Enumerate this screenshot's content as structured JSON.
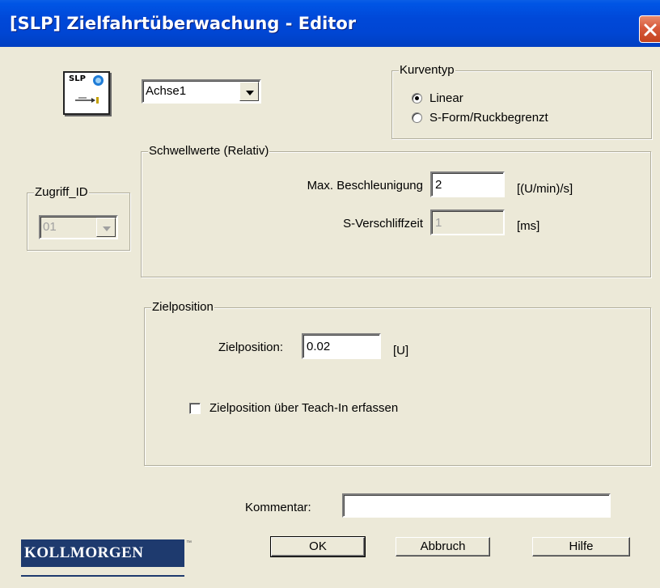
{
  "window": {
    "title": "[SLP] Zielfahrtüberwachung - Editor"
  },
  "icon": {
    "label": "SLP"
  },
  "axis": {
    "selected": "Achse1"
  },
  "kurventyp": {
    "legend": "Kurventyp",
    "options": [
      {
        "label": "Linear",
        "checked": true
      },
      {
        "label": "S-Form/Ruckbegrenzt",
        "checked": false
      }
    ]
  },
  "zugriff": {
    "legend": "Zugriff_ID",
    "selected": "01",
    "enabled": false
  },
  "schwellwerte": {
    "legend": "Schwellwerte (Relativ)",
    "max_accel_label": "Max. Beschleunigung",
    "max_accel_value": "2",
    "max_accel_unit": "[(U/min)/s]",
    "s_time_label": "S-Verschliffzeit",
    "s_time_value": "1",
    "s_time_unit": "[ms]"
  },
  "zielposition": {
    "legend": "Zielposition",
    "label": "Zielposition:",
    "value": "0.02",
    "unit": "[U]",
    "teach_in_label": "Zielposition über Teach-In erfassen",
    "teach_in_checked": false
  },
  "kommentar": {
    "label": "Kommentar:",
    "value": ""
  },
  "buttons": {
    "ok": "OK",
    "cancel": "Abbruch",
    "help": "Hilfe"
  },
  "brand": {
    "logo": "KOLLMORGEN",
    "tm": "™"
  },
  "colors": {
    "titlebar": "#0048d8",
    "dialog_bg": "#ece9d8",
    "logo_bg": "#1e3a6e",
    "close": "#d75a3c"
  },
  "icons": [
    "close-icon",
    "slp-block-icon",
    "chevron-down-icon"
  ]
}
